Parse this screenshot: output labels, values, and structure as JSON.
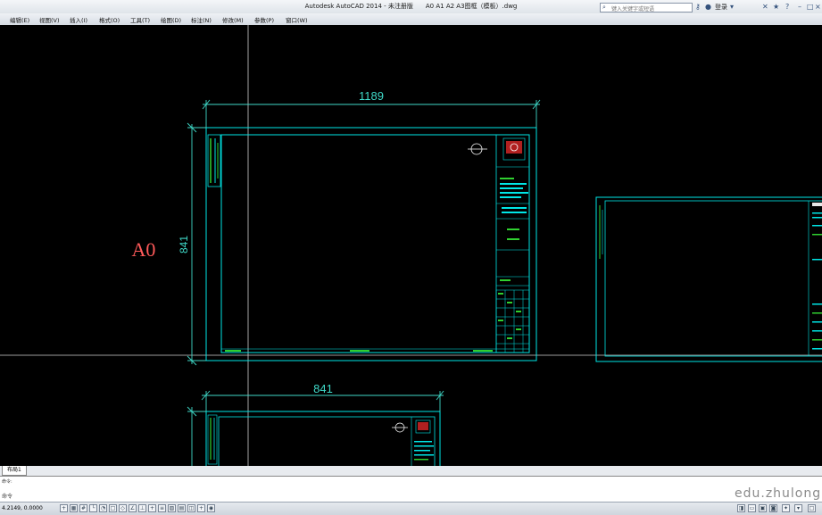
{
  "window": {
    "title": "Autodesk AutoCAD 2014 - 未注册版",
    "file": "A0 A1 A2 A3图框（模板）.dwg"
  },
  "search": {
    "placeholder": "键入关键字或短语"
  },
  "account": {
    "login_label": "登录"
  },
  "menu": [
    {
      "label": "编辑(E)",
      "name": "menu-edit"
    },
    {
      "label": "视图(V)",
      "name": "menu-view"
    },
    {
      "label": "插入(I)",
      "name": "menu-insert"
    },
    {
      "label": "格式(O)",
      "name": "menu-format"
    },
    {
      "label": "工具(T)",
      "name": "menu-tools"
    },
    {
      "label": "绘图(D)",
      "name": "menu-draw"
    },
    {
      "label": "标注(N)",
      "name": "menu-dimension"
    },
    {
      "label": "修改(M)",
      "name": "menu-modify"
    },
    {
      "label": "参数(P)",
      "name": "menu-parametric"
    },
    {
      "label": "窗口(W)",
      "name": "menu-window"
    }
  ],
  "drawing": {
    "a0_width_dim": "1189",
    "a0_height_dim": "841",
    "a0_label": "A0",
    "a1_width_dim": "841"
  },
  "tabs": {
    "layout_tab": "布局1"
  },
  "command": {
    "history": "命令:",
    "prompt": "命令"
  },
  "status": {
    "coordinates": "4.2149, 0.0000"
  },
  "watermark": "edu.zhulong",
  "colors": {
    "background": "#000000",
    "drawing_cyan": "#00e6e6",
    "dim_text": "#3fd9c8",
    "label_red": "#ff5a5a",
    "title_green": "#30d030",
    "ribbon_gray": "#dfe4ea"
  },
  "icons": [
    "search-icon",
    "key-icon",
    "user-icon",
    "exchange-icon",
    "star-icon",
    "help-icon",
    "minimize-icon",
    "maximize-icon",
    "close-icon"
  ]
}
